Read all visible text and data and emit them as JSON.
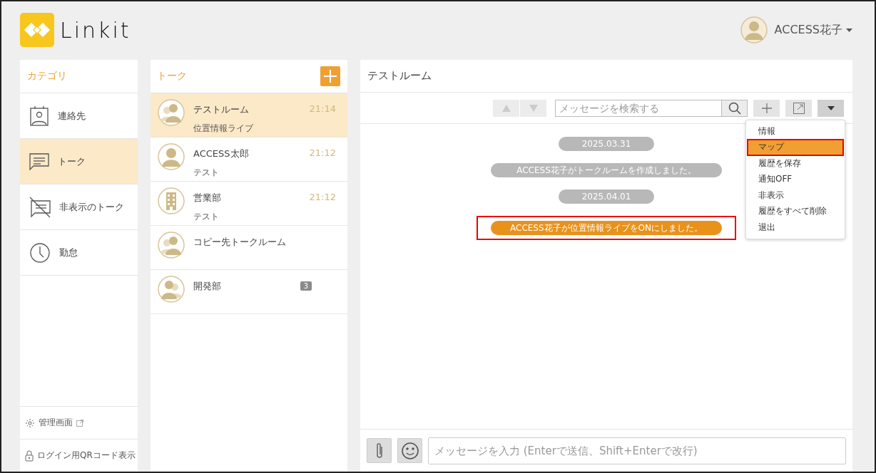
{
  "header": {
    "logo_text": "Linkit",
    "user_name": "ACCESS花子"
  },
  "categories": {
    "title": "カテゴリ",
    "items": [
      {
        "label": "連絡先",
        "kind": "contacts",
        "selected": false
      },
      {
        "label": "トーク",
        "kind": "talk",
        "selected": true
      },
      {
        "label": "非表示のトーク",
        "kind": "hidden",
        "selected": false
      },
      {
        "label": "勤怠",
        "kind": "attendance",
        "selected": false
      }
    ],
    "footer_links": [
      {
        "label": "管理画面",
        "kind": "admin"
      },
      {
        "label": "ログイン用QRコード表示",
        "kind": "qr"
      }
    ]
  },
  "talk_list": {
    "title": "トーク",
    "rooms": [
      {
        "name": "テストルーム",
        "preview": "位置情報ライブ",
        "time": "21:14",
        "kind": "group",
        "selected": true
      },
      {
        "name": "ACCESS太郎",
        "preview": "テスト",
        "time": "21:12",
        "kind": "person",
        "selected": false
      },
      {
        "name": "営業部",
        "preview": "テスト",
        "time": "21:12",
        "kind": "building",
        "selected": false
      },
      {
        "name": "コピー先トークルーム",
        "kind": "group",
        "selected": false
      },
      {
        "name": "開発部",
        "badge": "3",
        "kind": "group_alt",
        "selected": false
      }
    ]
  },
  "chat": {
    "title": "テストルーム",
    "search_placeholder": "メッセージを検索する",
    "menu": [
      {
        "label": "情報",
        "highlighted": false
      },
      {
        "label": "マップ",
        "highlighted": true
      },
      {
        "label": "履歴を保存",
        "highlighted": false
      },
      {
        "label": "通知OFF",
        "highlighted": false
      },
      {
        "label": "非表示",
        "highlighted": false
      },
      {
        "label": "履歴をすべて削除",
        "highlighted": false
      },
      {
        "label": "退出",
        "highlighted": false
      }
    ],
    "messages": [
      {
        "kind": "date",
        "text": "2025.03.31",
        "highlighted": false
      },
      {
        "kind": "system",
        "text": "ACCESS花子がトークルームを作成しました。",
        "highlighted": false
      },
      {
        "kind": "date",
        "text": "2025.04.01",
        "highlighted": false
      },
      {
        "kind": "system",
        "text": "ACCESS花子が位置情報ライブをONにしました。",
        "highlighted": true
      }
    ],
    "composer_placeholder": "メッセージを入力 (Enterで送信、Shift+Enterで改行)"
  }
}
